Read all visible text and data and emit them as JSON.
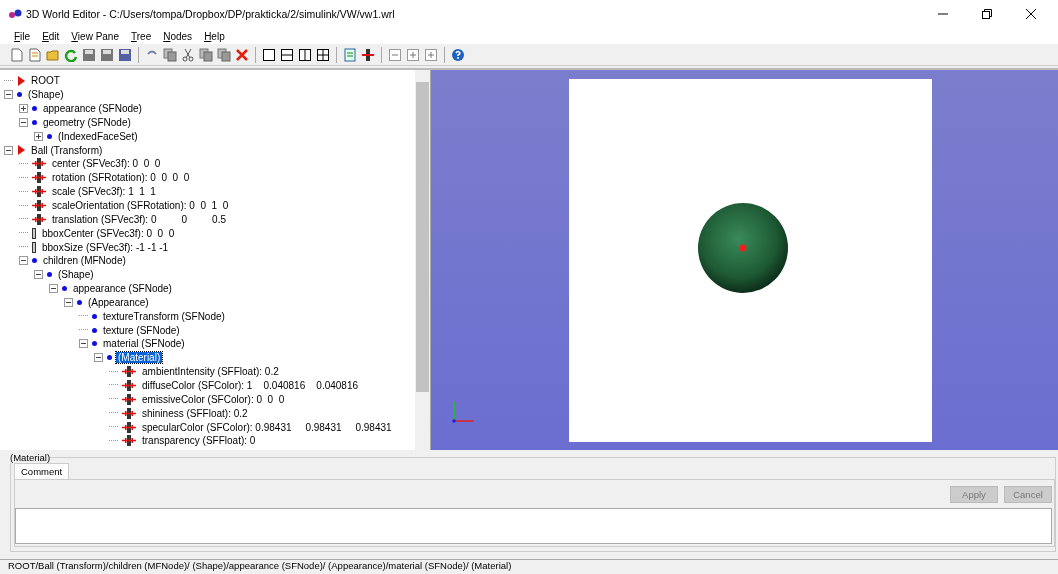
{
  "window": {
    "title": "3D World Editor - C:/Users/tompa/Dropbox/DP/prakticka/2/simulink/VW/vw1.wrl"
  },
  "menu": [
    "File",
    "Edit",
    "View Pane",
    "Tree",
    "Nodes",
    "Help"
  ],
  "tree": [
    {
      "label": "ROOT",
      "kind": "node",
      "selected": false
    },
    {
      "label": "(Shape)",
      "kind": "sfnode",
      "expanded": true,
      "selected": false,
      "children": [
        {
          "label": "appearance (SFNode)",
          "kind": "sfnode",
          "expanded": false,
          "selected": false
        },
        {
          "label": "geometry (SFNode)",
          "kind": "sfnode",
          "expanded": true,
          "selected": false,
          "children": [
            {
              "label": "(IndexedFaceSet)",
              "kind": "sfnode",
              "expanded": false,
              "selected": false
            }
          ]
        }
      ]
    },
    {
      "label": "Ball (Transform)",
      "kind": "node",
      "expanded": true,
      "selected": false,
      "children": [
        {
          "label": "center (SFVec3f): 0  0  0",
          "kind": "field",
          "selected": false
        },
        {
          "label": "rotation (SFRotation): 0  0  0  0",
          "kind": "field",
          "selected": false
        },
        {
          "label": "scale (SFVec3f): 1  1  1",
          "kind": "field",
          "selected": false
        },
        {
          "label": "scaleOrientation (SFRotation): 0  0  1  0",
          "kind": "field",
          "selected": false
        },
        {
          "label": "translation (SFVec3f): 0         0         0.5",
          "kind": "field",
          "selected": false
        },
        {
          "label": "bboxCenter (SFVec3f): 0  0  0",
          "kind": "bbox",
          "selected": false
        },
        {
          "label": "bboxSize (SFVec3f): -1 -1 -1",
          "kind": "bbox",
          "selected": false
        },
        {
          "label": "children (MFNode)",
          "kind": "sfnode",
          "expanded": true,
          "selected": false,
          "children": [
            {
              "label": "(Shape)",
              "kind": "sfnode",
              "expanded": true,
              "selected": false,
              "children": [
                {
                  "label": "appearance (SFNode)",
                  "kind": "sfnode",
                  "expanded": true,
                  "selected": false,
                  "children": [
                    {
                      "label": "(Appearance)",
                      "kind": "sfnode",
                      "expanded": true,
                      "selected": false,
                      "children": [
                        {
                          "label": "textureTransform (SFNode)",
                          "kind": "sfnode",
                          "selected": false
                        },
                        {
                          "label": "texture (SFNode)",
                          "kind": "sfnode",
                          "selected": false
                        },
                        {
                          "label": "material (SFNode)",
                          "kind": "sfnode",
                          "expanded": true,
                          "selected": false,
                          "children": [
                            {
                              "label": "(Material)",
                              "kind": "sfnode",
                              "expanded": true,
                              "selected": true,
                              "children": [
                                {
                                  "label": "ambientIntensity (SFFloat): 0.2",
                                  "kind": "field",
                                  "selected": false
                                },
                                {
                                  "label": "diffuseColor (SFColor): 1    0.040816    0.040816",
                                  "kind": "field",
                                  "selected": false
                                },
                                {
                                  "label": "emissiveColor (SFColor): 0  0  0",
                                  "kind": "field",
                                  "selected": false
                                },
                                {
                                  "label": "shininess (SFFloat): 0.2",
                                  "kind": "field",
                                  "selected": false
                                },
                                {
                                  "label": "specularColor (SFColor): 0.98431     0.98431     0.98431",
                                  "kind": "field",
                                  "selected": false
                                },
                                {
                                  "label": "transparency (SFFloat): 0",
                                  "kind": "field",
                                  "selected": false
                                }
                              ]
                            }
                          ]
                        }
                      ]
                    }
                  ]
                }
              ]
            }
          ]
        }
      ]
    }
  ],
  "panel": {
    "title": "(Material)",
    "tabs": [
      {
        "label": "Comment",
        "selected": true
      }
    ],
    "apply": "Apply",
    "cancel": "Cancel"
  },
  "status_bar": "ROOT/Ball (Transform)/children (MFNode)/ (Shape)/appearance (SFNode)/ (Appearance)/material (SFNode)/ (Material)"
}
